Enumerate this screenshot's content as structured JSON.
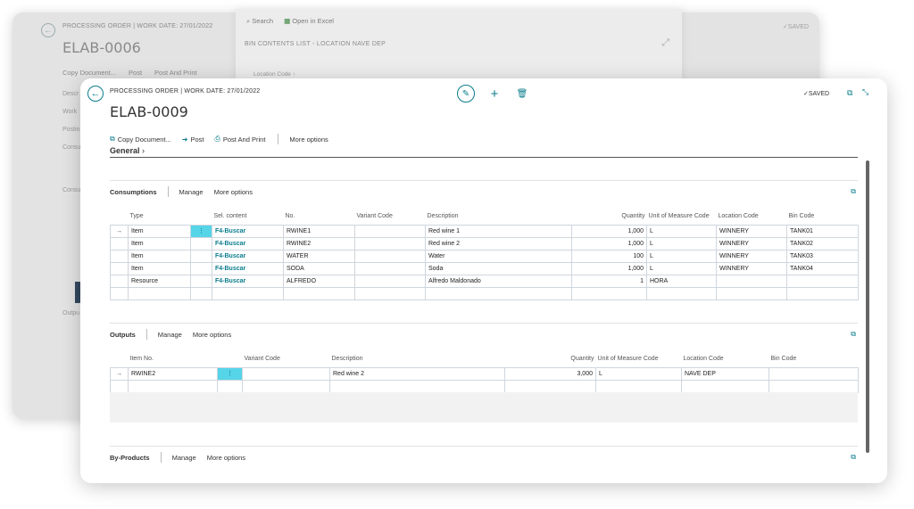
{
  "background_window": {
    "caption": "PROCESSING ORDER | WORK DATE: 27/01/2022",
    "title": "ELAB-0006",
    "actions": [
      "Copy Document...",
      "Post",
      "Post And Print"
    ],
    "side_labels": [
      "Descr",
      "Work",
      "Postin",
      "Consu",
      "Consu",
      "Outpu"
    ],
    "saved": "✓SAVED"
  },
  "bin_window": {
    "search": "Search",
    "open_excel": "Open in Excel",
    "title": "BIN CONTENTS LIST - LOCATION NAVE DEP",
    "sub": "Location Code ↑"
  },
  "main": {
    "caption": "PROCESSING ORDER | WORK DATE: 27/01/2022",
    "title": "ELAB-0009",
    "saved": "SAVED",
    "actions": {
      "copy": "Copy Document...",
      "post": "Post",
      "post_print": "Post And Print",
      "more": "More options"
    },
    "general": "General"
  },
  "consumptions": {
    "title": "Consumptions",
    "manage": "Manage",
    "more": "More options",
    "columns": [
      "Type",
      "Sel. content",
      "No.",
      "Variant Code",
      "Description",
      "Quantity",
      "Unit of Measure Code",
      "Location Code",
      "Bin Code"
    ],
    "rows": [
      {
        "type": "Item",
        "sel": "F4-Buscar",
        "no": "RWINE1",
        "variant": "",
        "desc": "Red wine 1",
        "qty": "1,000",
        "uom": "L",
        "loc": "WINNERY",
        "bin": "TANK01"
      },
      {
        "type": "Item",
        "sel": "F4-Buscar",
        "no": "RWINE2",
        "variant": "",
        "desc": "Red wine 2",
        "qty": "1,000",
        "uom": "L",
        "loc": "WINNERY",
        "bin": "TANK02"
      },
      {
        "type": "Item",
        "sel": "F4-Buscar",
        "no": "WATER",
        "variant": "",
        "desc": "Water",
        "qty": "100",
        "uom": "L",
        "loc": "WINNERY",
        "bin": "TANK03"
      },
      {
        "type": "Item",
        "sel": "F4-Buscar",
        "no": "SODA",
        "variant": "",
        "desc": "Soda",
        "qty": "1,000",
        "uom": "L",
        "loc": "WINNERY",
        "bin": "TANK04"
      },
      {
        "type": "Resource",
        "sel": "F4-Buscar",
        "no": "ALFREDO",
        "variant": "",
        "desc": "Alfredo Maldonado",
        "qty": "1",
        "uom": "HORA",
        "loc": "",
        "bin": ""
      }
    ]
  },
  "outputs": {
    "title": "Outputs",
    "manage": "Manage",
    "more": "More options",
    "columns": [
      "Item No.",
      "Variant Code",
      "Description",
      "Quantity",
      "Unit of Measure Code",
      "Location Code",
      "Bin Code"
    ],
    "rows": [
      {
        "item": "RWINE2",
        "variant": "",
        "desc": "Red wine 2",
        "qty": "3,000",
        "uom": "L",
        "loc": "NAVE DEP",
        "bin": ""
      }
    ]
  },
  "byproducts": {
    "title": "By-Products",
    "manage": "Manage",
    "more": "More options"
  }
}
